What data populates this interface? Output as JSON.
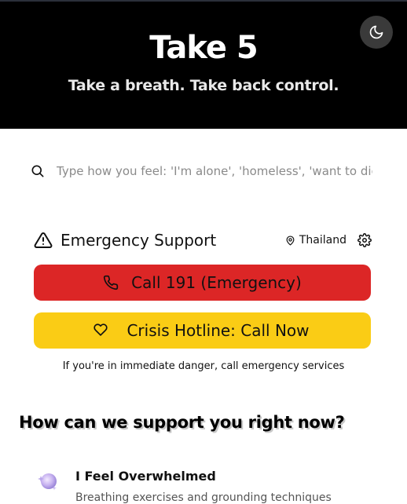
{
  "header": {
    "title": "Take 5",
    "tagline": "Take a breath. Take back control.",
    "theme_toggle_icon": "moon-icon",
    "background": "#000000"
  },
  "search": {
    "placeholder": "Type how you feel: 'I'm alone', 'homeless', 'want to die'...",
    "value": ""
  },
  "emergency": {
    "title": "Emergency Support",
    "location": "Thailand",
    "call_button_label": "Call 191 (Emergency)",
    "call_button_color": "#dc2626",
    "crisis_button_label": "Crisis Hotline: Call Now",
    "crisis_button_color": "#facc15",
    "note": "If you're in immediate danger, call emergency services"
  },
  "support": {
    "title": "How can we support you right now?",
    "cards": [
      {
        "title": "I Feel Overwhelmed",
        "description": "Breathing exercises and grounding techniques",
        "icon": "sparkle-orb-icon"
      }
    ]
  }
}
